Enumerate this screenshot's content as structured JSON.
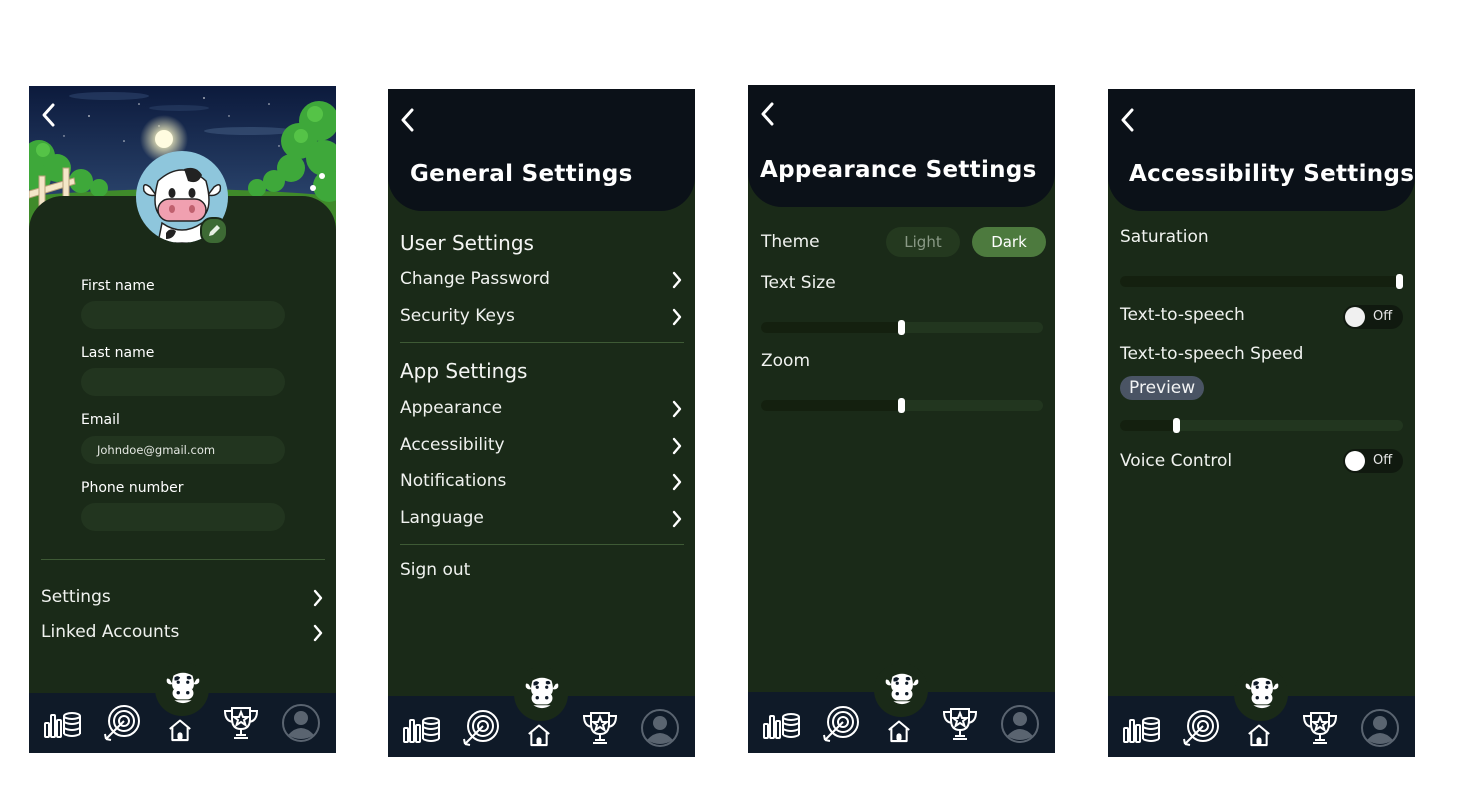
{
  "profile": {
    "fields": [
      {
        "label": "First name",
        "value": ""
      },
      {
        "label": "Last name",
        "value": ""
      },
      {
        "label": "Email",
        "value": "Johndoe@gmail.com"
      },
      {
        "label": "Phone number",
        "value": ""
      }
    ],
    "menu": [
      "Settings",
      "Linked Accounts"
    ]
  },
  "general": {
    "title": "General Settings",
    "user_section": "User Settings",
    "user_items": [
      "Change Password",
      "Security Keys"
    ],
    "app_section": "App Settings",
    "app_items": [
      "Appearance",
      "Accessibility",
      "Notifications",
      "Language"
    ],
    "sign_out": "Sign out"
  },
  "appearance": {
    "title": "Appearance Settings",
    "theme_label": "Theme",
    "theme_options": [
      "Light",
      "Dark"
    ],
    "theme_selected": "Dark",
    "text_size_label": "Text Size",
    "text_size_level": 0.5,
    "zoom_label": "Zoom",
    "zoom_level": 0.5
  },
  "accessibility": {
    "title": "Accessibility Settings",
    "saturation_label": "Saturation",
    "saturation_level": 1.0,
    "tts_label": "Text-to-speech",
    "tts_state": "Off",
    "tts_speed_label": "Text-to-speech Speed",
    "preview_label": "Preview",
    "tts_speed_level": 0.2,
    "voice_label": "Voice Control",
    "voice_state": "Off"
  },
  "tabbar": {
    "icons": [
      "stats-icon",
      "target-icon",
      "home-icon",
      "trophy-icon",
      "profile-icon"
    ]
  },
  "colors": {
    "background": "#1a2a18",
    "header": "#0b1118",
    "tabbar": "#0f1a28",
    "field": "#22351f",
    "accent_green": "#4d7a3e"
  }
}
